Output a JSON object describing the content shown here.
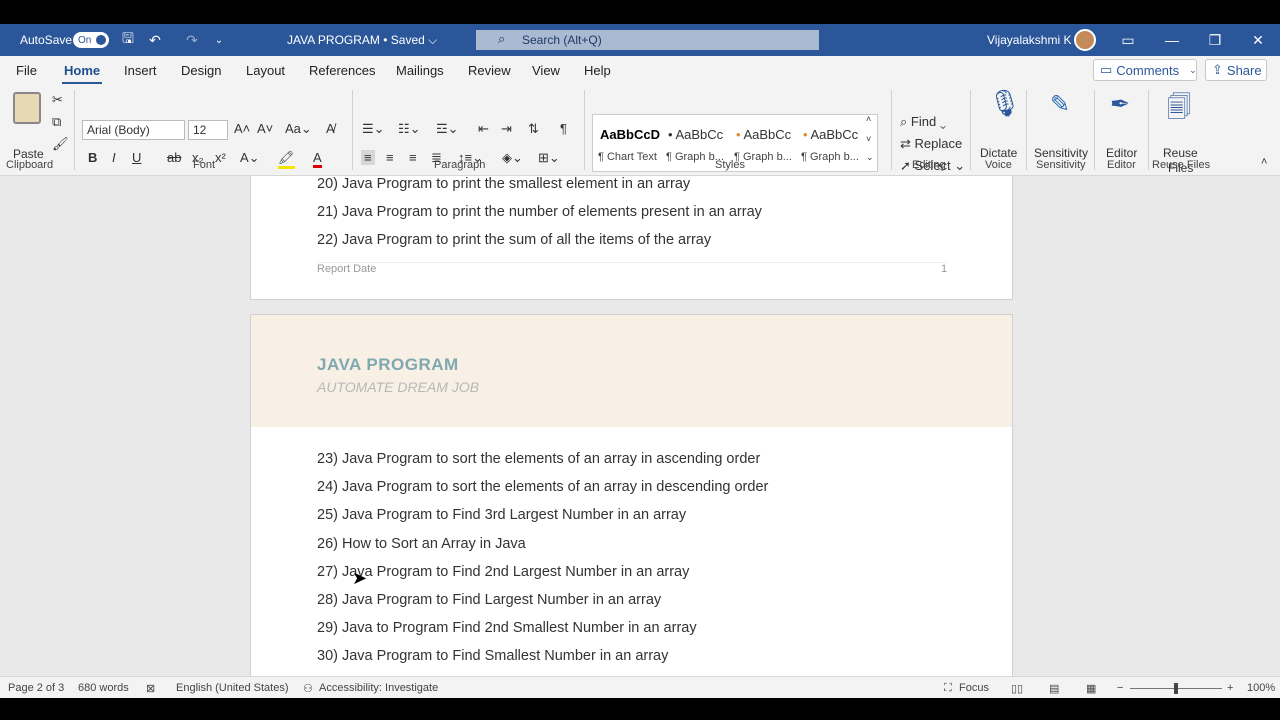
{
  "titlebar": {
    "autosave_label": "AutoSave",
    "autosave_state": "On",
    "doc_title": "JAVA PROGRAM • Saved ⌵",
    "search_placeholder": "Search (Alt+Q)",
    "user_name": "Vijayalakshmi K"
  },
  "tabs": [
    "File",
    "Home",
    "Insert",
    "Design",
    "Layout",
    "References",
    "Mailings",
    "Review",
    "View",
    "Help"
  ],
  "actions": {
    "comments": "Comments",
    "share": "Share"
  },
  "ribbon": {
    "clipboard": {
      "paste": "Paste",
      "label": "Clipboard"
    },
    "font": {
      "name": "Arial (Body)",
      "size": "12",
      "label": "Font"
    },
    "paragraph": {
      "label": "Paragraph"
    },
    "styles": {
      "label": "Styles",
      "items": [
        {
          "preview": "AaBbCcD",
          "name": "¶ Chart Text"
        },
        {
          "preview": "AaBbCc",
          "name": "¶ Graph b..."
        },
        {
          "preview": "AaBbCc",
          "name": "¶ Graph b..."
        },
        {
          "preview": "AaBbCc",
          "name": "¶ Graph b..."
        }
      ]
    },
    "editing": {
      "find": "Find",
      "replace": "Replace",
      "select": "Select",
      "label": "Editing"
    },
    "voice": {
      "dictate": "Dictate",
      "label": "Voice"
    },
    "sensitivity": {
      "button": "Sensitivity",
      "label": "Sensitivity"
    },
    "editor": {
      "button": "Editor",
      "label": "Editor"
    },
    "reuse": {
      "button_line1": "Reuse",
      "button_line2": "Files",
      "label": "Reuse Files"
    }
  },
  "document": {
    "page1_lines": [
      "20) Java Program to print the smallest element in an array",
      "21) Java Program to print the number of elements present in an array",
      "22) Java Program to print the sum of all the items of the array"
    ],
    "page1_footer_left": "Report Date",
    "page1_footer_right": "1",
    "header_title": "JAVA PROGRAM",
    "header_subtitle": "AUTOMATE DREAM JOB",
    "page2_lines": [
      "23) Java Program to sort the elements of an array in ascending order",
      "24) Java Program to sort the elements of an array in descending order",
      "25) Java Program to Find 3rd Largest Number in an array",
      "26) How to Sort an Array in Java",
      "27) Java Program to Find 2nd Largest Number in an array",
      "28) Java Program to Find Largest Number in an array",
      "29) Java to Program Find 2nd Smallest Number in an array",
      "30) Java Program to Find Smallest Number in an array"
    ]
  },
  "status": {
    "page": "Page 2 of 3",
    "words": "680 words",
    "language": "English (United States)",
    "accessibility": "Accessibility: Investigate",
    "focus": "Focus",
    "zoom": "100%"
  }
}
